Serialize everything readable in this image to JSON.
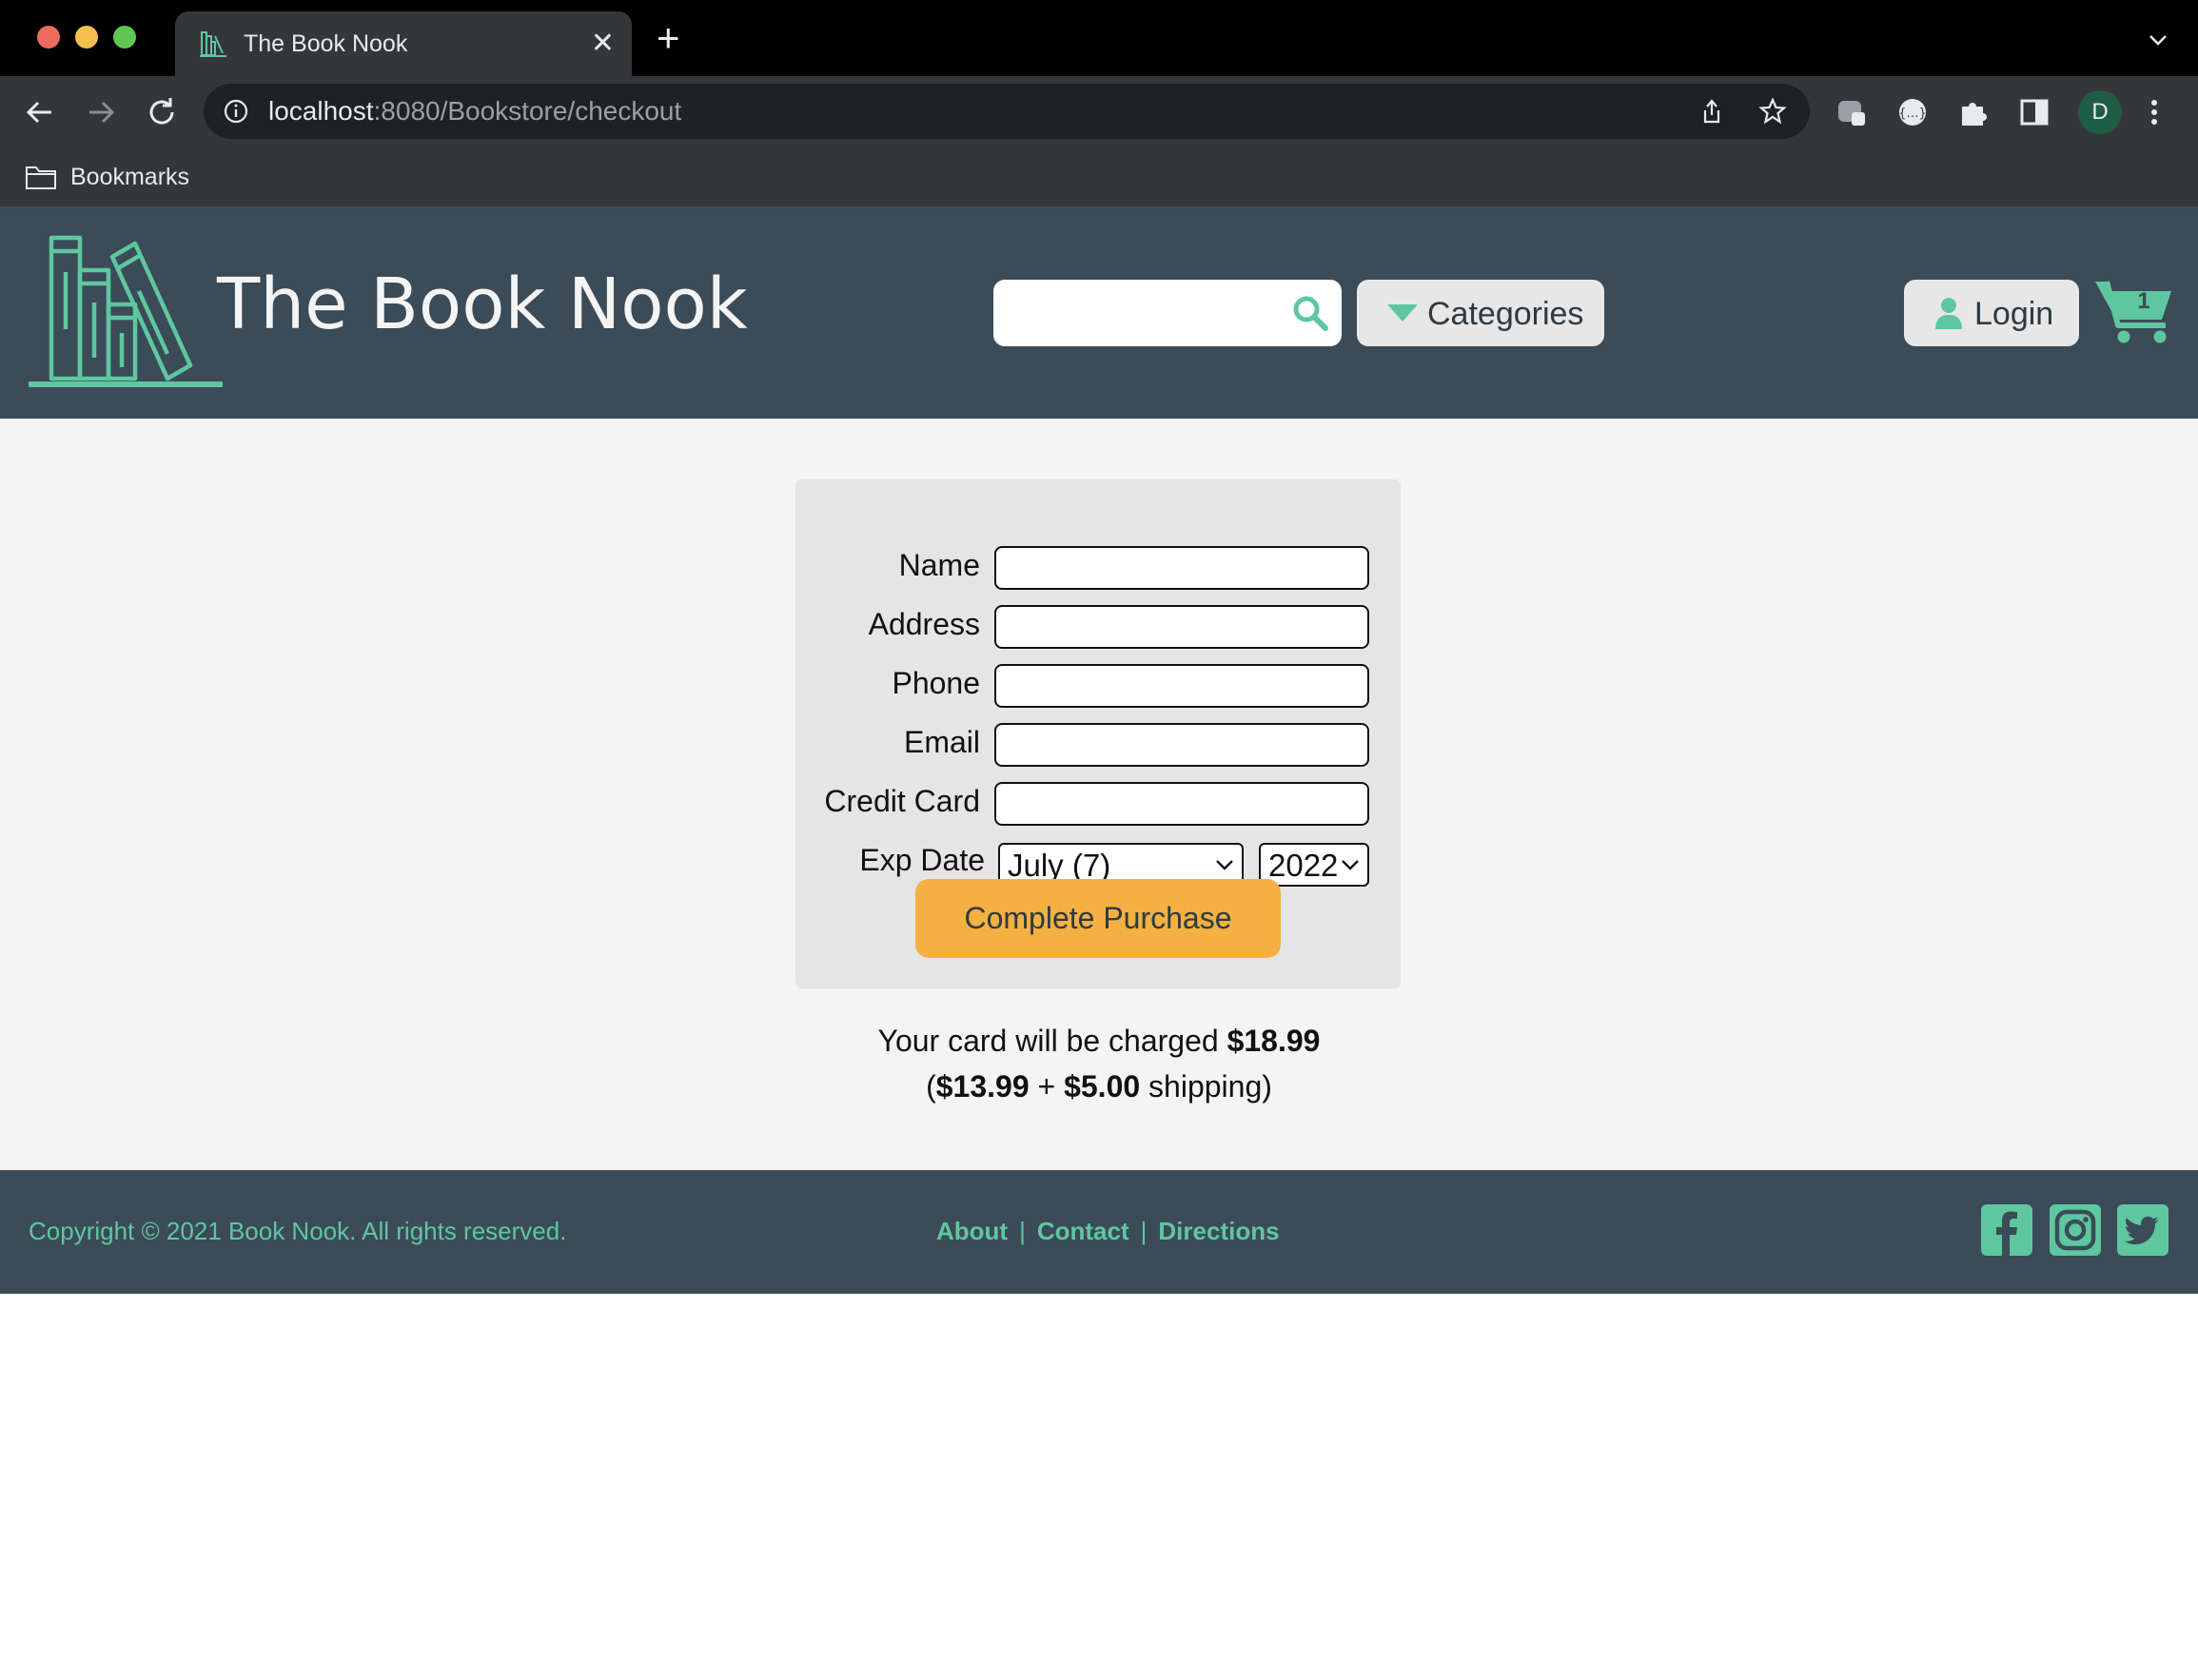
{
  "browser": {
    "tab_title": "The Book Nook",
    "url_host": "localhost",
    "url_path": ":8080/Bookstore/checkout",
    "avatar_letter": "D",
    "bookmarks_label": "Bookmarks"
  },
  "header": {
    "brand": "The Book Nook",
    "search": {
      "placeholder": "",
      "value": ""
    },
    "categories_label": "Categories",
    "login_label": "Login",
    "cart_count": "1",
    "accent_color": "#5ec7a0",
    "header_color": "#3b4b57"
  },
  "checkout": {
    "fields": {
      "name": {
        "label": "Name",
        "value": ""
      },
      "address": {
        "label": "Address",
        "value": ""
      },
      "phone": {
        "label": "Phone",
        "value": ""
      },
      "email": {
        "label": "Email",
        "value": ""
      },
      "credit_card": {
        "label": "Credit Card",
        "value": ""
      }
    },
    "exp_date": {
      "label": "Exp Date",
      "month": "July (7)",
      "year": "2022"
    },
    "submit_label": "Complete Purchase",
    "submit_color": "#f4b040",
    "charge": {
      "prefix": "Your card will be charged",
      "total": "$18.99",
      "open_paren": "(",
      "subtotal": "$13.99",
      "plus": "+",
      "shipping_cost": "$5.00",
      "shipping_word": "shipping)"
    }
  },
  "footer": {
    "copyright": "Copyright © 2021 Book Nook. All rights reserved.",
    "links": [
      "About",
      "Contact",
      "Directions"
    ],
    "separator": "|",
    "social_icons": [
      "facebook-icon",
      "instagram-icon",
      "twitter-icon"
    ]
  }
}
